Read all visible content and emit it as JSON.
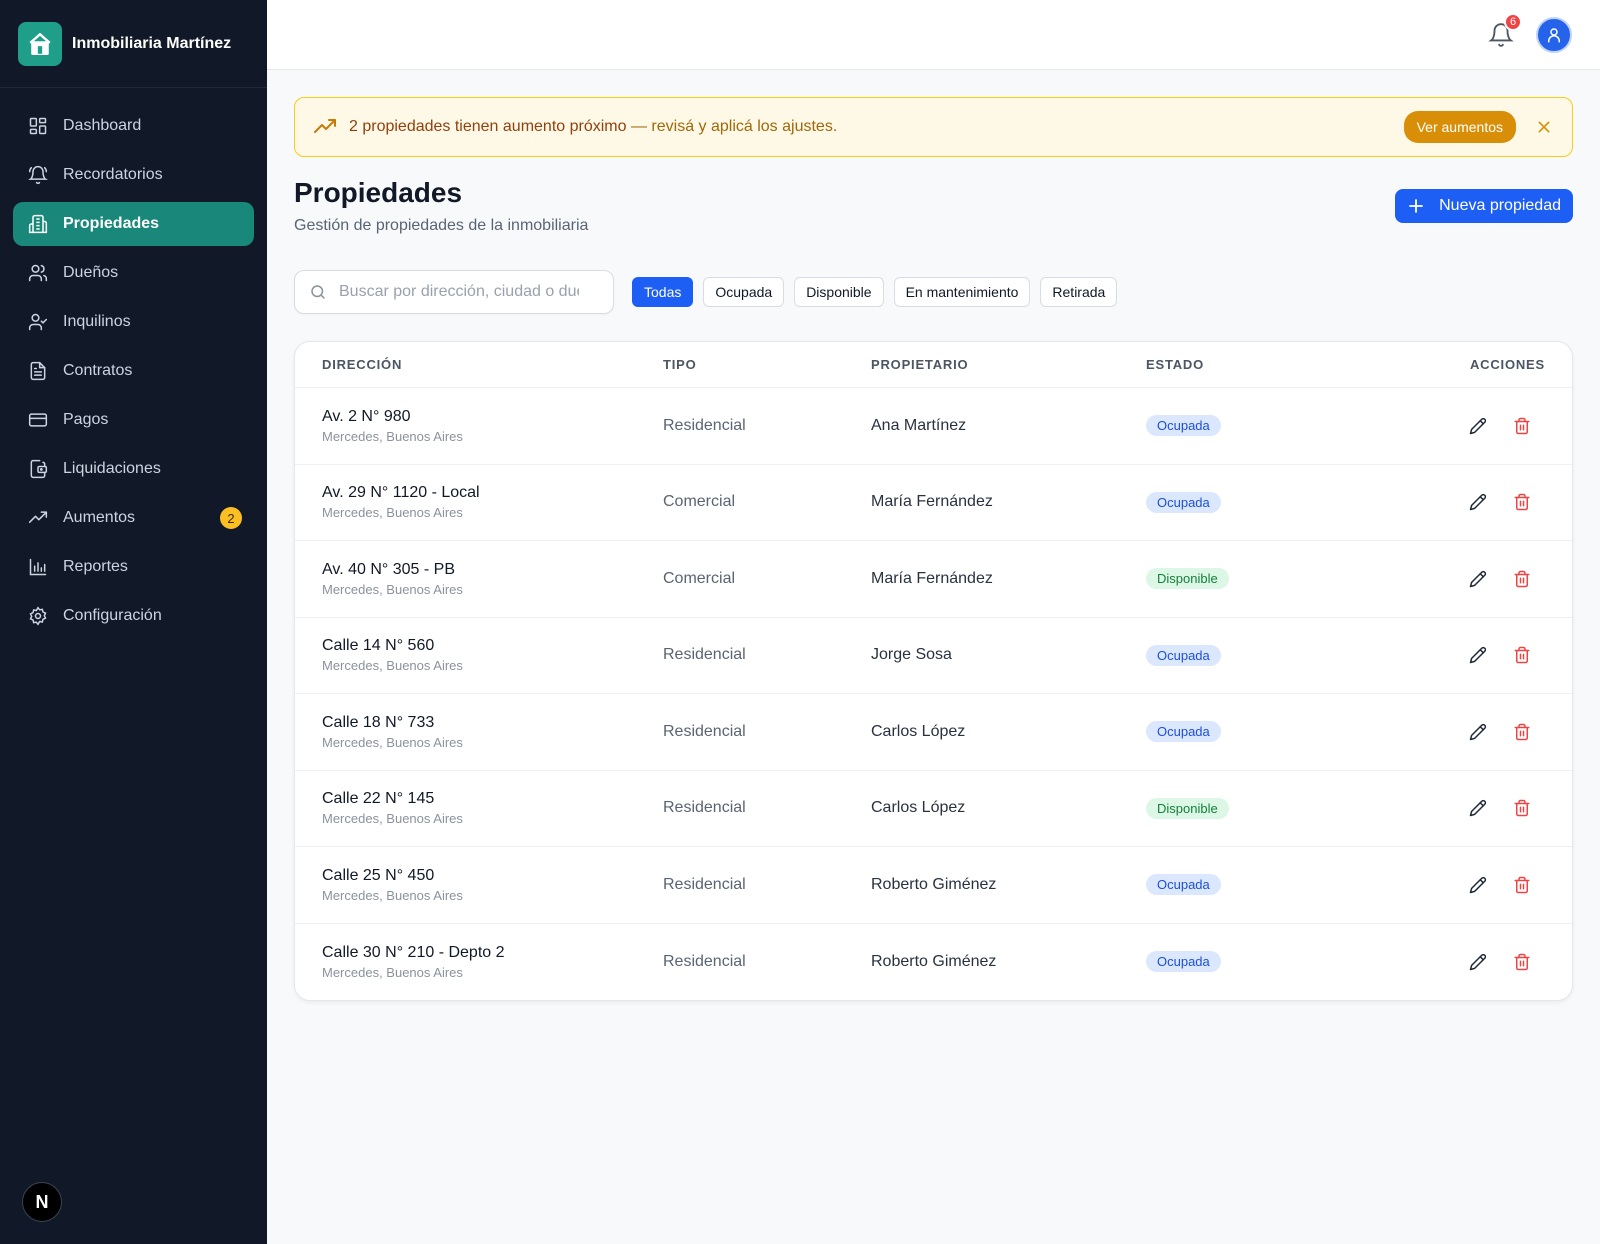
{
  "brand": {
    "name": "Inmobiliaria Martínez"
  },
  "sidebar": {
    "items": [
      {
        "label": "Dashboard",
        "icon": "dashboard-icon"
      },
      {
        "label": "Recordatorios",
        "icon": "bell-ring-icon"
      },
      {
        "label": "Propiedades",
        "icon": "building-icon",
        "active": true
      },
      {
        "label": "Dueños",
        "icon": "users-icon"
      },
      {
        "label": "Inquilinos",
        "icon": "user-check-icon"
      },
      {
        "label": "Contratos",
        "icon": "file-text-icon"
      },
      {
        "label": "Pagos",
        "icon": "credit-card-icon"
      },
      {
        "label": "Liquidaciones",
        "icon": "wallet-icon"
      },
      {
        "label": "Aumentos",
        "icon": "trending-up-icon",
        "badge": "2"
      },
      {
        "label": "Reportes",
        "icon": "bar-chart-icon"
      },
      {
        "label": "Configuración",
        "icon": "gear-icon"
      }
    ],
    "footer_letter": "N"
  },
  "topbar": {
    "notifications": "6"
  },
  "alert": {
    "strong_text": "2 propiedades tienen aumento próximo",
    "soft_text": " — revisá y aplicá los ajustes.",
    "button": "Ver aumentos"
  },
  "page": {
    "title": "Propiedades",
    "subtitle": "Gestión de propiedades de la inmobiliaria",
    "new_button": "Nueva propiedad"
  },
  "search": {
    "placeholder": "Buscar por dirección, ciudad o dueño"
  },
  "filters": [
    "Todas",
    "Ocupada",
    "Disponible",
    "En mantenimiento",
    "Retirada"
  ],
  "table": {
    "headers": [
      "DIRECCIÓN",
      "TIPO",
      "PROPIETARIO",
      "ESTADO",
      "ACCIONES"
    ],
    "rows": [
      {
        "address": "Av. 2 N° 980",
        "city": "Mercedes, Buenos Aires",
        "type": "Residencial",
        "owner": "Ana Martínez",
        "status": "Ocupada"
      },
      {
        "address": "Av. 29 N° 1120 - Local",
        "city": "Mercedes, Buenos Aires",
        "type": "Comercial",
        "owner": "María Fernández",
        "status": "Ocupada"
      },
      {
        "address": "Av. 40 N° 305 - PB",
        "city": "Mercedes, Buenos Aires",
        "type": "Comercial",
        "owner": "María Fernández",
        "status": "Disponible"
      },
      {
        "address": "Calle 14 N° 560",
        "city": "Mercedes, Buenos Aires",
        "type": "Residencial",
        "owner": "Jorge Sosa",
        "status": "Ocupada"
      },
      {
        "address": "Calle 18 N° 733",
        "city": "Mercedes, Buenos Aires",
        "type": "Residencial",
        "owner": "Carlos López",
        "status": "Ocupada"
      },
      {
        "address": "Calle 22 N° 145",
        "city": "Mercedes, Buenos Aires",
        "type": "Residencial",
        "owner": "Carlos López",
        "status": "Disponible"
      },
      {
        "address": "Calle 25 N° 450",
        "city": "Mercedes, Buenos Aires",
        "type": "Residencial",
        "owner": "Roberto Giménez",
        "status": "Ocupada"
      },
      {
        "address": "Calle 30 N° 210 - Depto 2",
        "city": "Mercedes, Buenos Aires",
        "type": "Residencial",
        "owner": "Roberto Giménez",
        "status": "Ocupada"
      }
    ]
  },
  "colors": {
    "sidebar_bg": "#111827",
    "active_nav": "#19877a",
    "primary": "#1d5ef5",
    "alert_bg": "#fef9e6",
    "alert_border": "#facc15",
    "badge_ocupada": "#dbe7fd",
    "badge_disponible": "#dcf7e5",
    "delete": "#ef4444"
  }
}
